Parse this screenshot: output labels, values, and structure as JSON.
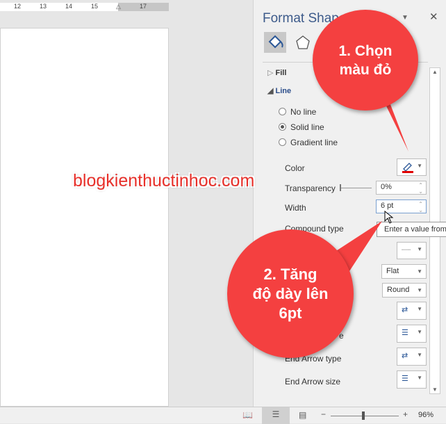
{
  "ruler": {
    "ticks": [
      "12",
      "13",
      "14",
      "15",
      "17"
    ]
  },
  "panel": {
    "title": "Format Shape",
    "close": "✕",
    "dropdown": "▼",
    "sections": {
      "fill": "Fill",
      "line": "Line"
    },
    "radios": [
      {
        "label": "No line",
        "checked": false
      },
      {
        "label": "Solid line",
        "checked": true
      },
      {
        "label": "Gradient line",
        "checked": false
      }
    ],
    "fields": {
      "color": "Color",
      "transparency": "Transparency",
      "transparency_value": "0%",
      "width": "Width",
      "width_value": "6 pt",
      "compound": "Compound type",
      "cap_value": "Flat",
      "join_value": "Round",
      "begin_arrow_size_partial": "e",
      "end_arrow_type": "End Arrow type",
      "end_arrow_size": "End Arrow size"
    },
    "tooltip": "Enter a value from",
    "line_color": "#e00000"
  },
  "status": {
    "zoom": "96%",
    "minus": "−",
    "plus": "+"
  },
  "annotations": {
    "callout1": [
      "1. Chọn",
      "màu đỏ"
    ],
    "callout2": [
      "2. Tăng",
      "độ dày lên",
      "6pt"
    ],
    "watermark": "blogkienthuctinhoc.com",
    "color": "#f44040"
  }
}
